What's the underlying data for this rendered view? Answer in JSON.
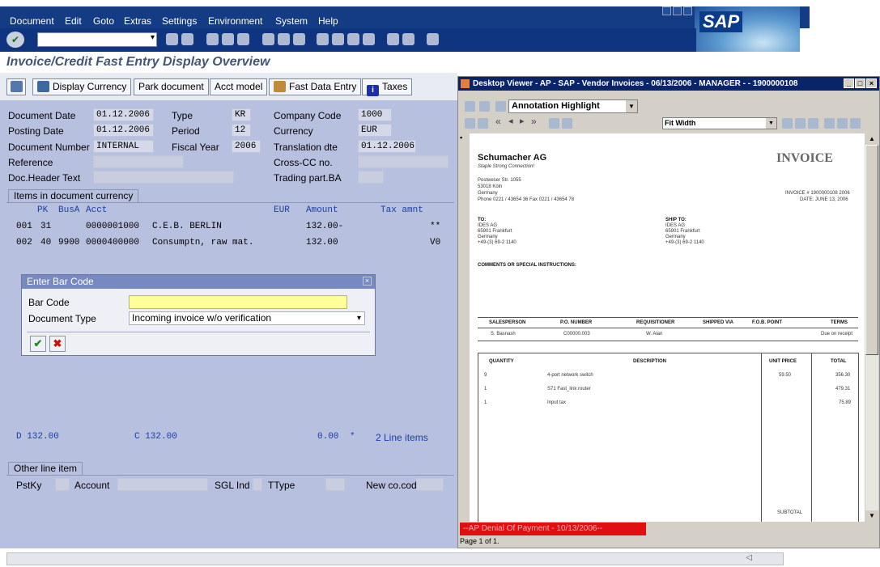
{
  "menubar": {
    "items": [
      "Document",
      "Edit",
      "Goto",
      "Extras",
      "Settings",
      "Environment",
      "System",
      "Help"
    ]
  },
  "brand": {
    "logo_text": "SAP"
  },
  "toolbar": {
    "command_placeholder": "",
    "ok_icon": "checkmark-icon"
  },
  "screen": {
    "title": "Invoice/Credit Fast Entry Display Overview"
  },
  "app_toolbar": {
    "display_currency": "Display Currency",
    "park_document": "Park document",
    "acct_model": "Acct model",
    "fast_data_entry": "Fast Data Entry",
    "taxes": "Taxes"
  },
  "header": {
    "document_date_label": "Document Date",
    "document_date": "01.12.2006",
    "type_label": "Type",
    "type": "KR",
    "company_code_label": "Company Code",
    "company_code": "1000",
    "posting_date_label": "Posting Date",
    "posting_date": "01.12.2006",
    "period_label": "Period",
    "period": "12",
    "currency_label": "Currency",
    "currency": "EUR",
    "document_number_label": "Document Number",
    "document_number": "INTERNAL",
    "fiscal_year_label": "Fiscal Year",
    "fiscal_year": "2006",
    "translation_dte_label": "Translation dte",
    "translation_dte": "01.12.2006",
    "reference_label": "Reference",
    "cross_cc_label": "Cross-CC no.",
    "doc_header_text_label": "Doc.Header Text",
    "trading_part_label": "Trading part.BA"
  },
  "items": {
    "tab_label": "Items in document currency",
    "columns": {
      "pk": "PK",
      "busa": "BusA",
      "acct": "Acct",
      "eur": "EUR",
      "amount": "Amount",
      "tax": "Tax amnt"
    },
    "rows": [
      {
        "no": "001",
        "pk": "31",
        "busa": "",
        "acct": "0000001000",
        "desc": "C.E.B. BERLIN",
        "amount": "132.00-",
        "tax": "**"
      },
      {
        "no": "002",
        "pk": "40",
        "busa": "9900",
        "acct": "0000400000",
        "desc": "Consumptn, raw mat.",
        "amount": "132.00",
        "tax": "V0"
      }
    ]
  },
  "dialog": {
    "title": "Enter Bar Code",
    "bar_code_label": "Bar Code",
    "bar_code": "",
    "document_type_label": "Document Type",
    "document_type": "Incoming invoice w/o verification"
  },
  "totals": {
    "debit": "D 132.00",
    "credit": "C 132.00",
    "balance": "0.00",
    "marker": "*",
    "line_items": "2 Line items"
  },
  "other_line": {
    "tab_label": "Other line item",
    "pstky_label": "PstKy",
    "account_label": "Account",
    "sgl_label": "SGL Ind",
    "ttype_label": "TType",
    "newco_label": "New co.code"
  },
  "viewer": {
    "title": "Desktop Viewer - AP - SAP - Vendor Invoices - 06/13/2006 - MANAGER - - 1900000108",
    "annotation_mode": "Annotation Highlight",
    "zoom": "Fit Width",
    "denial_banner": "--AP Denial Of Payment - 10/13/2006--",
    "page_info": "Page 1 of 1.",
    "invoice": {
      "company": "Schumacher AG",
      "tagline": "Staple Strong Connection!",
      "heading": "INVOICE",
      "addr1": "Postweser Str. 1055",
      "addr2": "53018 Köln",
      "addr3": "Germany",
      "addr4": "Phone 0221 / 43654 36   Fax 0221 / 43654 78",
      "inv_no": "INVOICE # 1900000108 2006",
      "inv_date": "DATE: JUNE 13, 2006",
      "to_label": "TO:",
      "to1": "IDES AG",
      "to2": "65901 Frankfurt",
      "to3": "Germany",
      "to4": "+49-(3) 69-2 1140",
      "ship_label": "SHIP TO:",
      "ship1": "IDES AG",
      "ship2": "65901 Frankfurt",
      "ship3": "Germany",
      "ship4": "+49-(3) 69-2 1140",
      "comments": "COMMENTS OR SPECIAL INSTRUCTIONS:",
      "h_sales": "SALESPERSON",
      "h_po": "P.O. NUMBER",
      "h_req": "REQUISITIONER",
      "h_ship": "SHIPPED VIA",
      "h_fob": "F.O.B. POINT",
      "h_terms": "TERMS",
      "v_sales": "S. Basnash",
      "v_po": "C00000.003",
      "v_req": "W. Alan",
      "v_terms": "Due on receipt",
      "h_qty": "QUANTITY",
      "h_desc": "DESCRIPTION",
      "h_unit": "UNIT PRICE",
      "h_total": "TOTAL",
      "lines": [
        {
          "qty": "9",
          "desc": "4-port network switch",
          "unit": "59.50",
          "total": "356.30"
        },
        {
          "qty": "1",
          "desc": "S71 Fast_link router",
          "unit": "",
          "total": "479.31"
        },
        {
          "qty": "1",
          "desc": "Input tax",
          "unit": "",
          "total": "75.89"
        }
      ],
      "subtotal": "SUBTOTAL"
    }
  },
  "colors": {
    "menu_bg": "#143c84",
    "panel_bg": "#b8c0e0",
    "bar_code_field": "#ffff99",
    "denial": "#e01010"
  }
}
